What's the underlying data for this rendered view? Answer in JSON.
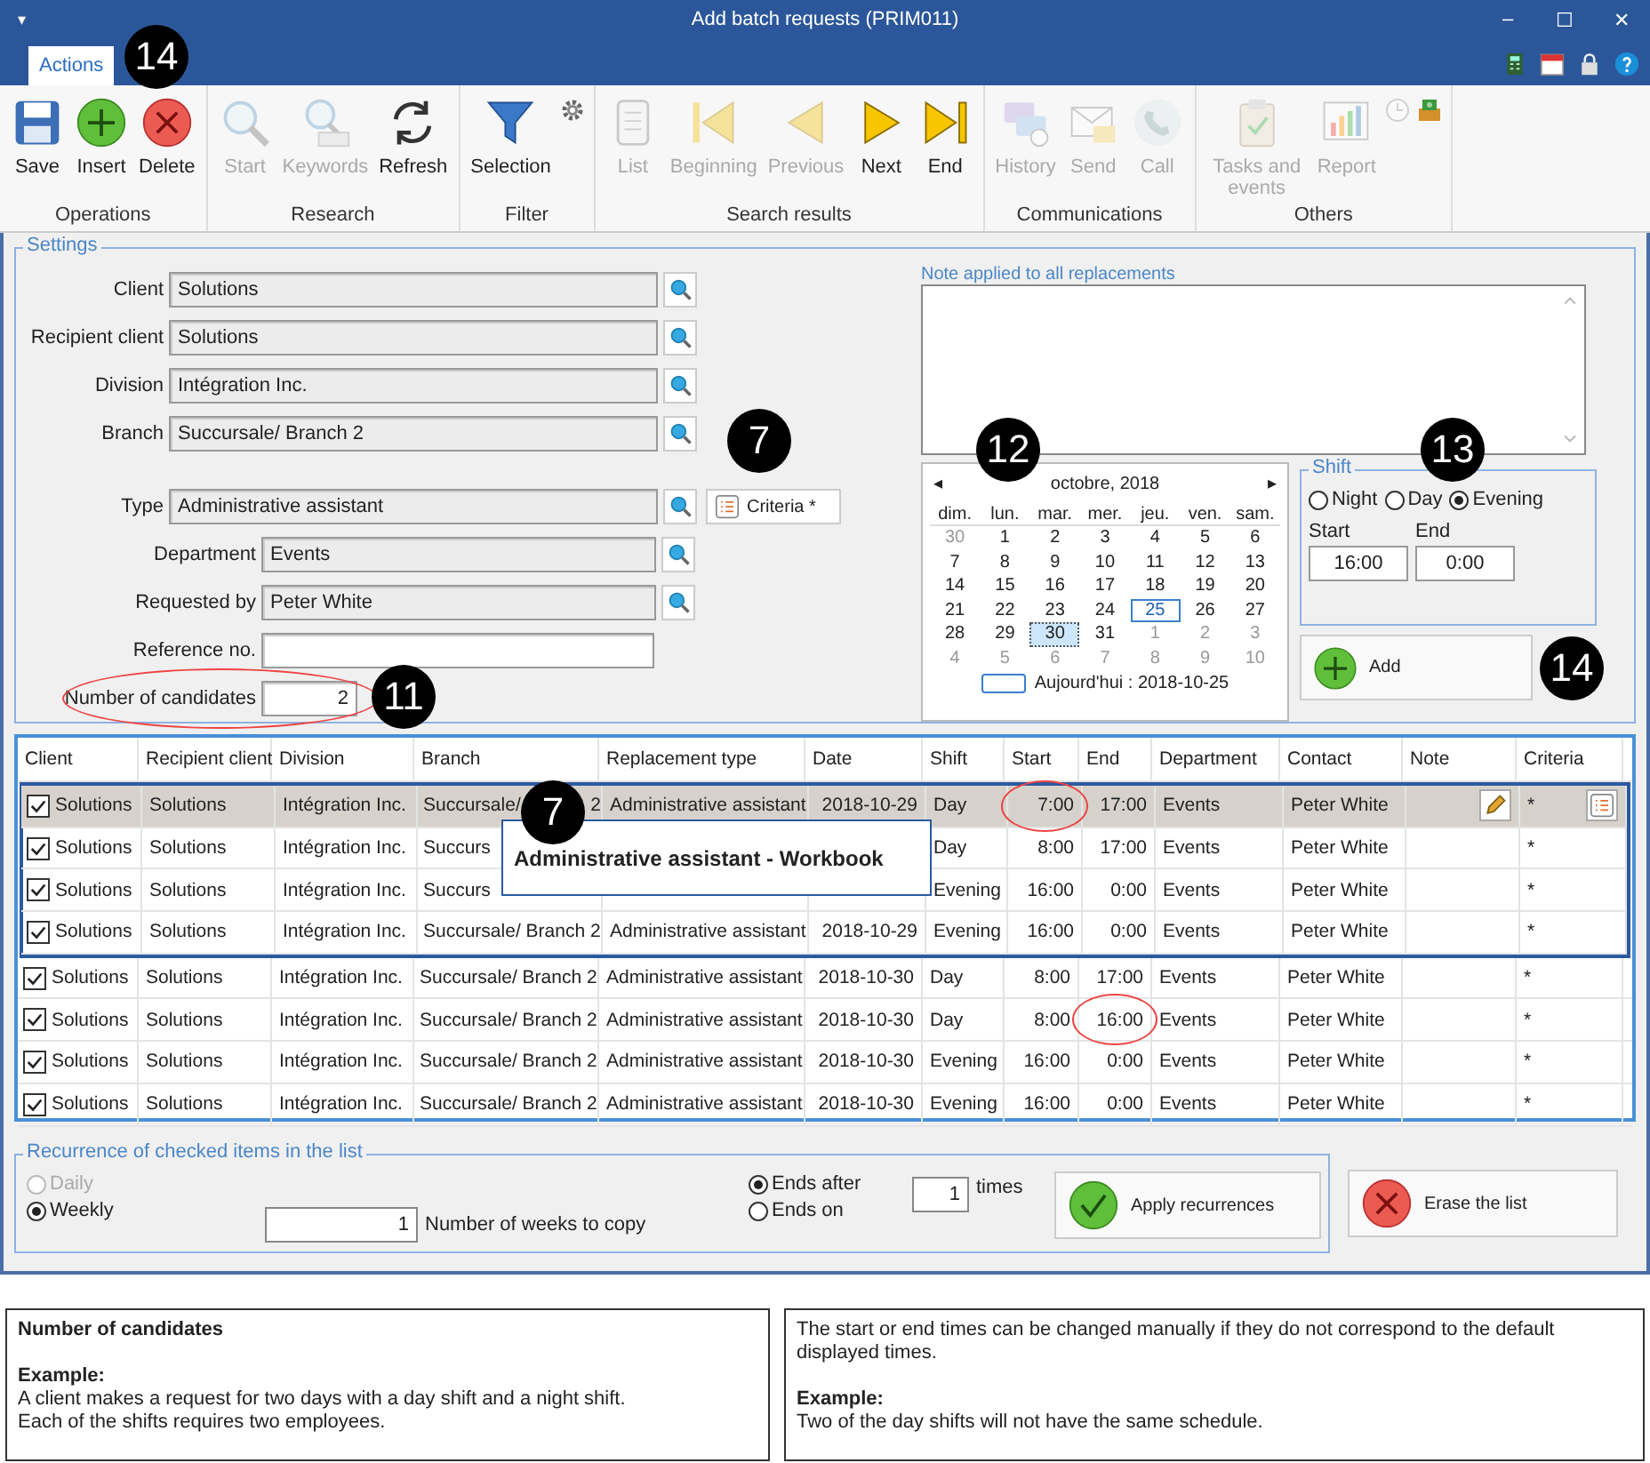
{
  "window": {
    "menu_glyph": "▾",
    "title": "Add batch requests (PRIM011)",
    "controls": [
      "–",
      "☐",
      "✕"
    ]
  },
  "tabs": [
    {
      "label": "Actions",
      "selected": true
    }
  ],
  "toolbar": {
    "callout": "14",
    "groups": [
      {
        "label": "Operations",
        "buttons": [
          {
            "kind": "large",
            "label": "Save",
            "disabled": false
          },
          {
            "kind": "large",
            "label": "Insert",
            "disabled": false
          },
          {
            "kind": "large",
            "label": "Delete",
            "disabled": false
          }
        ]
      },
      {
        "label": "Research",
        "buttons": [
          {
            "kind": "large",
            "label": "Start",
            "disabled": true
          },
          {
            "kind": "large",
            "label": "Keywords",
            "disabled": true
          },
          {
            "kind": "large",
            "label": "Refresh",
            "disabled": false
          }
        ]
      },
      {
        "label": "Filter",
        "buttons": [
          {
            "kind": "large",
            "label": "Selection",
            "disabled": false
          },
          {
            "kind": "small",
            "disabled": false
          }
        ]
      },
      {
        "label": "Search results",
        "buttons": [
          {
            "kind": "large",
            "label": "List",
            "disabled": true
          },
          {
            "kind": "large",
            "label": "Beginning",
            "disabled": true
          },
          {
            "kind": "large",
            "label": "Previous",
            "disabled": true
          },
          {
            "kind": "large",
            "label": "Next",
            "disabled": false
          },
          {
            "kind": "large",
            "label": "End",
            "disabled": false
          }
        ]
      },
      {
        "label": "Communications",
        "buttons": [
          {
            "kind": "large",
            "label": "History",
            "disabled": true
          },
          {
            "kind": "large",
            "label": "Send",
            "disabled": true
          },
          {
            "kind": "large",
            "label": "Call",
            "disabled": true
          }
        ]
      },
      {
        "label": "Others",
        "buttons": [
          {
            "kind": "large",
            "label": "Tasks and events",
            "disabled": true
          },
          {
            "kind": "large",
            "label": "Report",
            "disabled": true
          },
          {
            "kind": "small",
            "disabled": true
          },
          {
            "kind": "small",
            "disabled": false
          }
        ]
      }
    ]
  },
  "settings": {
    "legend": "Settings",
    "fields": [
      {
        "kind": "lookup",
        "label": "Client",
        "value": "Solutions"
      },
      {
        "kind": "lookup",
        "label": "Recipient client",
        "value": "Solutions"
      },
      {
        "kind": "lookup",
        "label": "Division",
        "value": "Intégration Inc."
      },
      {
        "kind": "lookup",
        "label": "Branch",
        "value": "Succursale/ Branch 2",
        "callout": "7"
      },
      {
        "kind": "lookup",
        "label": "Type",
        "value": "Administrative assistant",
        "criteria_button": "Criteria *"
      },
      {
        "kind": "lookup",
        "label": "Department",
        "value": "Events"
      },
      {
        "kind": "lookup",
        "label": "Requested by",
        "value": "Peter White"
      },
      {
        "kind": "text",
        "label": "Reference no."
      },
      {
        "kind": "number",
        "label": "Number of candidates",
        "value": "2",
        "circled": true,
        "callout": "11"
      }
    ],
    "note": {
      "label": "Note applied to all replacements"
    },
    "calendar": {
      "callout": "12",
      "prev": "◂",
      "next": "▸",
      "month": "octobre, 2018",
      "weekdays": [
        "dim.",
        "lun.",
        "mar.",
        "mer.",
        "jeu.",
        "ven.",
        "sam."
      ],
      "weeks": [
        [
          {
            "d": "30",
            "muted": true,
            "today": false,
            "selected": false
          },
          {
            "d": "1",
            "muted": false,
            "today": false,
            "selected": false
          },
          {
            "d": "2",
            "muted": false,
            "today": false,
            "selected": false
          },
          {
            "d": "3",
            "muted": false,
            "today": false,
            "selected": false
          },
          {
            "d": "4",
            "muted": false,
            "today": false,
            "selected": false
          },
          {
            "d": "5",
            "muted": false,
            "today": false,
            "selected": false
          },
          {
            "d": "6",
            "muted": false,
            "today": false,
            "selected": false
          }
        ],
        [
          {
            "d": "7",
            "muted": false,
            "today": false,
            "selected": false
          },
          {
            "d": "8",
            "muted": false,
            "today": false,
            "selected": false
          },
          {
            "d": "9",
            "muted": false,
            "today": false,
            "selected": false
          },
          {
            "d": "10",
            "muted": false,
            "today": false,
            "selected": false
          },
          {
            "d": "11",
            "muted": false,
            "today": false,
            "selected": false
          },
          {
            "d": "12",
            "muted": false,
            "today": false,
            "selected": false
          },
          {
            "d": "13",
            "muted": false,
            "today": false,
            "selected": false
          }
        ],
        [
          {
            "d": "14",
            "muted": false,
            "today": false,
            "selected": false
          },
          {
            "d": "15",
            "muted": false,
            "today": false,
            "selected": false
          },
          {
            "d": "16",
            "muted": false,
            "today": false,
            "selected": false
          },
          {
            "d": "17",
            "muted": false,
            "today": false,
            "selected": false
          },
          {
            "d": "18",
            "muted": false,
            "today": false,
            "selected": false
          },
          {
            "d": "19",
            "muted": false,
            "today": false,
            "selected": false
          },
          {
            "d": "20",
            "muted": false,
            "today": false,
            "selected": false
          }
        ],
        [
          {
            "d": "21",
            "muted": false,
            "today": false,
            "selected": false
          },
          {
            "d": "22",
            "muted": false,
            "today": false,
            "selected": false
          },
          {
            "d": "23",
            "muted": false,
            "today": false,
            "selected": false
          },
          {
            "d": "24",
            "muted": false,
            "today": false,
            "selected": false
          },
          {
            "d": "25",
            "muted": false,
            "today": true,
            "selected": false
          },
          {
            "d": "26",
            "muted": false,
            "today": false,
            "selected": false
          },
          {
            "d": "27",
            "muted": false,
            "today": false,
            "selected": false
          }
        ],
        [
          {
            "d": "28",
            "muted": false,
            "today": false,
            "selected": false
          },
          {
            "d": "29",
            "muted": false,
            "today": false,
            "selected": false
          },
          {
            "d": "30",
            "muted": false,
            "today": false,
            "selected": true
          },
          {
            "d": "31",
            "muted": false,
            "today": false,
            "selected": false
          },
          {
            "d": "1",
            "muted": true,
            "today": false,
            "selected": false
          },
          {
            "d": "2",
            "muted": true,
            "today": false,
            "selected": false
          },
          {
            "d": "3",
            "muted": true,
            "today": false,
            "selected": false
          }
        ],
        [
          {
            "d": "4",
            "muted": true,
            "today": false,
            "selected": false
          },
          {
            "d": "5",
            "muted": true,
            "today": false,
            "selected": false
          },
          {
            "d": "6",
            "muted": true,
            "today": false,
            "selected": false
          },
          {
            "d": "7",
            "muted": true,
            "today": false,
            "selected": false
          },
          {
            "d": "8",
            "muted": true,
            "today": false,
            "selected": false
          },
          {
            "d": "9",
            "muted": true,
            "today": false,
            "selected": false
          },
          {
            "d": "10",
            "muted": true,
            "today": false,
            "selected": false
          }
        ]
      ],
      "today_label": "Aujourd'hui : 2018-10-25"
    },
    "shift": {
      "legend": "Shift",
      "callout": "13",
      "options": [
        {
          "label": "Night",
          "selected": false
        },
        {
          "label": "Day",
          "selected": false
        },
        {
          "label": "Evening",
          "selected": true
        }
      ],
      "start_label": "Start",
      "start": "16:00",
      "end_label": "End",
      "end": "0:00"
    },
    "add": {
      "label": "Add",
      "callout": "14"
    }
  },
  "table": {
    "callout": "7",
    "tooltip": "Administrative assistant - Workbook",
    "columns": [
      "Client",
      "Recipient client",
      "Division",
      "Branch",
      "Replacement type",
      "Date",
      "Shift",
      "Start",
      "End",
      "Department",
      "Contact",
      "Note",
      "Criteria"
    ],
    "rows": [
      {
        "checked": true,
        "selected": true,
        "grouped": true,
        "client": "Solutions",
        "recipient": "Solutions",
        "division": "Intégration Inc.",
        "branch": "Succursale/",
        "branch_end": "2",
        "type": "Administrative assistant",
        "date": "2018-10-29",
        "shift": "Day",
        "start": "7:00",
        "start_circled": true,
        "end": "17:00",
        "end_circled": false,
        "department": "Events",
        "contact": "Peter White",
        "criteria": "*"
      },
      {
        "checked": true,
        "selected": false,
        "grouped": true,
        "client": "Solutions",
        "recipient": "Solutions",
        "division": "Intégration Inc.",
        "branch": "Succurs",
        "shift": "Day",
        "start": "8:00",
        "start_circled": false,
        "end": "17:00",
        "end_circled": false,
        "department": "Events",
        "contact": "Peter White",
        "criteria": "*"
      },
      {
        "checked": true,
        "selected": false,
        "grouped": true,
        "client": "Solutions",
        "recipient": "Solutions",
        "division": "Intégration Inc.",
        "branch": "Succurs",
        "shift": "Evening",
        "start": "16:00",
        "start_circled": false,
        "end": "0:00",
        "end_circled": false,
        "department": "Events",
        "contact": "Peter White",
        "criteria": "*"
      },
      {
        "checked": true,
        "selected": false,
        "grouped": true,
        "client": "Solutions",
        "recipient": "Solutions",
        "division": "Intégration Inc.",
        "branch": "Succursale/ Branch 2",
        "type": "Administrative assistant",
        "date": "2018-10-29",
        "shift": "Evening",
        "start": "16:00",
        "start_circled": false,
        "end": "0:00",
        "end_circled": false,
        "department": "Events",
        "contact": "Peter White",
        "criteria": "*"
      },
      {
        "checked": true,
        "selected": false,
        "grouped": false,
        "client": "Solutions",
        "recipient": "Solutions",
        "division": "Intégration Inc.",
        "branch": "Succursale/ Branch 2",
        "type": "Administrative assistant",
        "date": "2018-10-30",
        "shift": "Day",
        "start": "8:00",
        "start_circled": false,
        "end": "17:00",
        "end_circled": false,
        "department": "Events",
        "contact": "Peter White",
        "criteria": "*"
      },
      {
        "checked": true,
        "selected": false,
        "grouped": false,
        "client": "Solutions",
        "recipient": "Solutions",
        "division": "Intégration Inc.",
        "branch": "Succursale/ Branch 2",
        "type": "Administrative assistant",
        "date": "2018-10-30",
        "shift": "Day",
        "start": "8:00",
        "start_circled": false,
        "end": "16:00",
        "end_circled": true,
        "department": "Events",
        "contact": "Peter White",
        "criteria": "*"
      },
      {
        "checked": true,
        "selected": false,
        "grouped": false,
        "client": "Solutions",
        "recipient": "Solutions",
        "division": "Intégration Inc.",
        "branch": "Succursale/ Branch 2",
        "type": "Administrative assistant",
        "date": "2018-10-30",
        "shift": "Evening",
        "start": "16:00",
        "start_circled": false,
        "end": "0:00",
        "end_circled": false,
        "department": "Events",
        "contact": "Peter White",
        "criteria": "*"
      },
      {
        "checked": true,
        "selected": false,
        "grouped": false,
        "client": "Solutions",
        "recipient": "Solutions",
        "division": "Intégration Inc.",
        "branch": "Succursale/ Branch 2",
        "type": "Administrative assistant",
        "date": "2018-10-30",
        "shift": "Evening",
        "start": "16:00",
        "start_circled": false,
        "end": "0:00",
        "end_circled": false,
        "department": "Events",
        "contact": "Peter White",
        "criteria": "*"
      }
    ]
  },
  "recurrence": {
    "legend": "Recurrence of checked items in the list",
    "frequency": [
      {
        "label": "Daily",
        "selected": false,
        "disabled": true
      },
      {
        "label": "Weekly",
        "selected": true,
        "disabled": false
      }
    ],
    "weeks": "1",
    "weeks_label": "Number of weeks to copy",
    "ending": [
      {
        "label": "Ends after",
        "selected": true,
        "disabled": false
      },
      {
        "label": "Ends on",
        "selected": false,
        "disabled": false
      }
    ],
    "times": "1",
    "times_label": "times",
    "apply": "Apply recurrences",
    "erase": "Erase the list"
  },
  "notes": [
    {
      "heading": "Number of candidates",
      "example_label": "Example:",
      "lines": [
        "A client makes a request for two days with a day shift and a night shift.",
        "Each of the shifts requires two employees."
      ]
    },
    {
      "intro": "The start or end times can be changed manually if they do not correspond to the default displayed times.",
      "example_label": "Example:",
      "lines": [
        "Two of the day shifts will not have the same schedule."
      ]
    }
  ]
}
